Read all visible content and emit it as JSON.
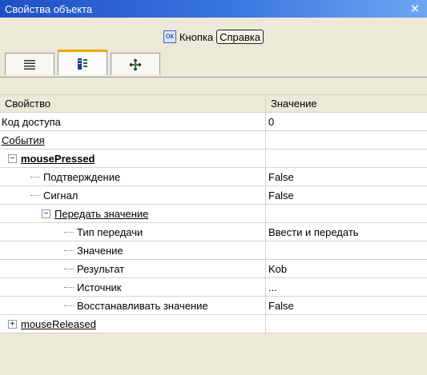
{
  "window": {
    "title": "Свойства объекта",
    "close_glyph": "✕"
  },
  "object": {
    "badge": "ок",
    "name": "Кнопка",
    "help_label": "Справка"
  },
  "tabs": [
    {
      "icon": "list-icon",
      "active": false
    },
    {
      "icon": "properties-icon",
      "active": true
    },
    {
      "icon": "move-icon",
      "active": false
    }
  ],
  "grid": {
    "headers": {
      "property": "Свойство",
      "value": "Значение"
    },
    "rows": [
      {
        "prop": "Код доступа",
        "value": "0"
      },
      {
        "prop": "События",
        "value": ""
      },
      {
        "prop": "mousePressed",
        "value": "",
        "expander": "−"
      },
      {
        "prop": "Подтверждение",
        "value": "False"
      },
      {
        "prop": "Сигнал",
        "value": "False"
      },
      {
        "prop": "Передать значение",
        "value": "",
        "expander": "−"
      },
      {
        "prop": "Тип передачи",
        "value": "Ввести и передать"
      },
      {
        "prop": "Значение",
        "value": ""
      },
      {
        "prop": "Результат",
        "value": "Kob"
      },
      {
        "prop": "Источник",
        "value": "..."
      },
      {
        "prop": "Восстанавливать значение",
        "value": "False"
      },
      {
        "prop": "mouseReleased",
        "value": "",
        "expander": "+"
      }
    ]
  },
  "colors": {
    "titlebar": "#3a78e0",
    "active_tab": "#f0a400",
    "background": "#ece9d8"
  }
}
